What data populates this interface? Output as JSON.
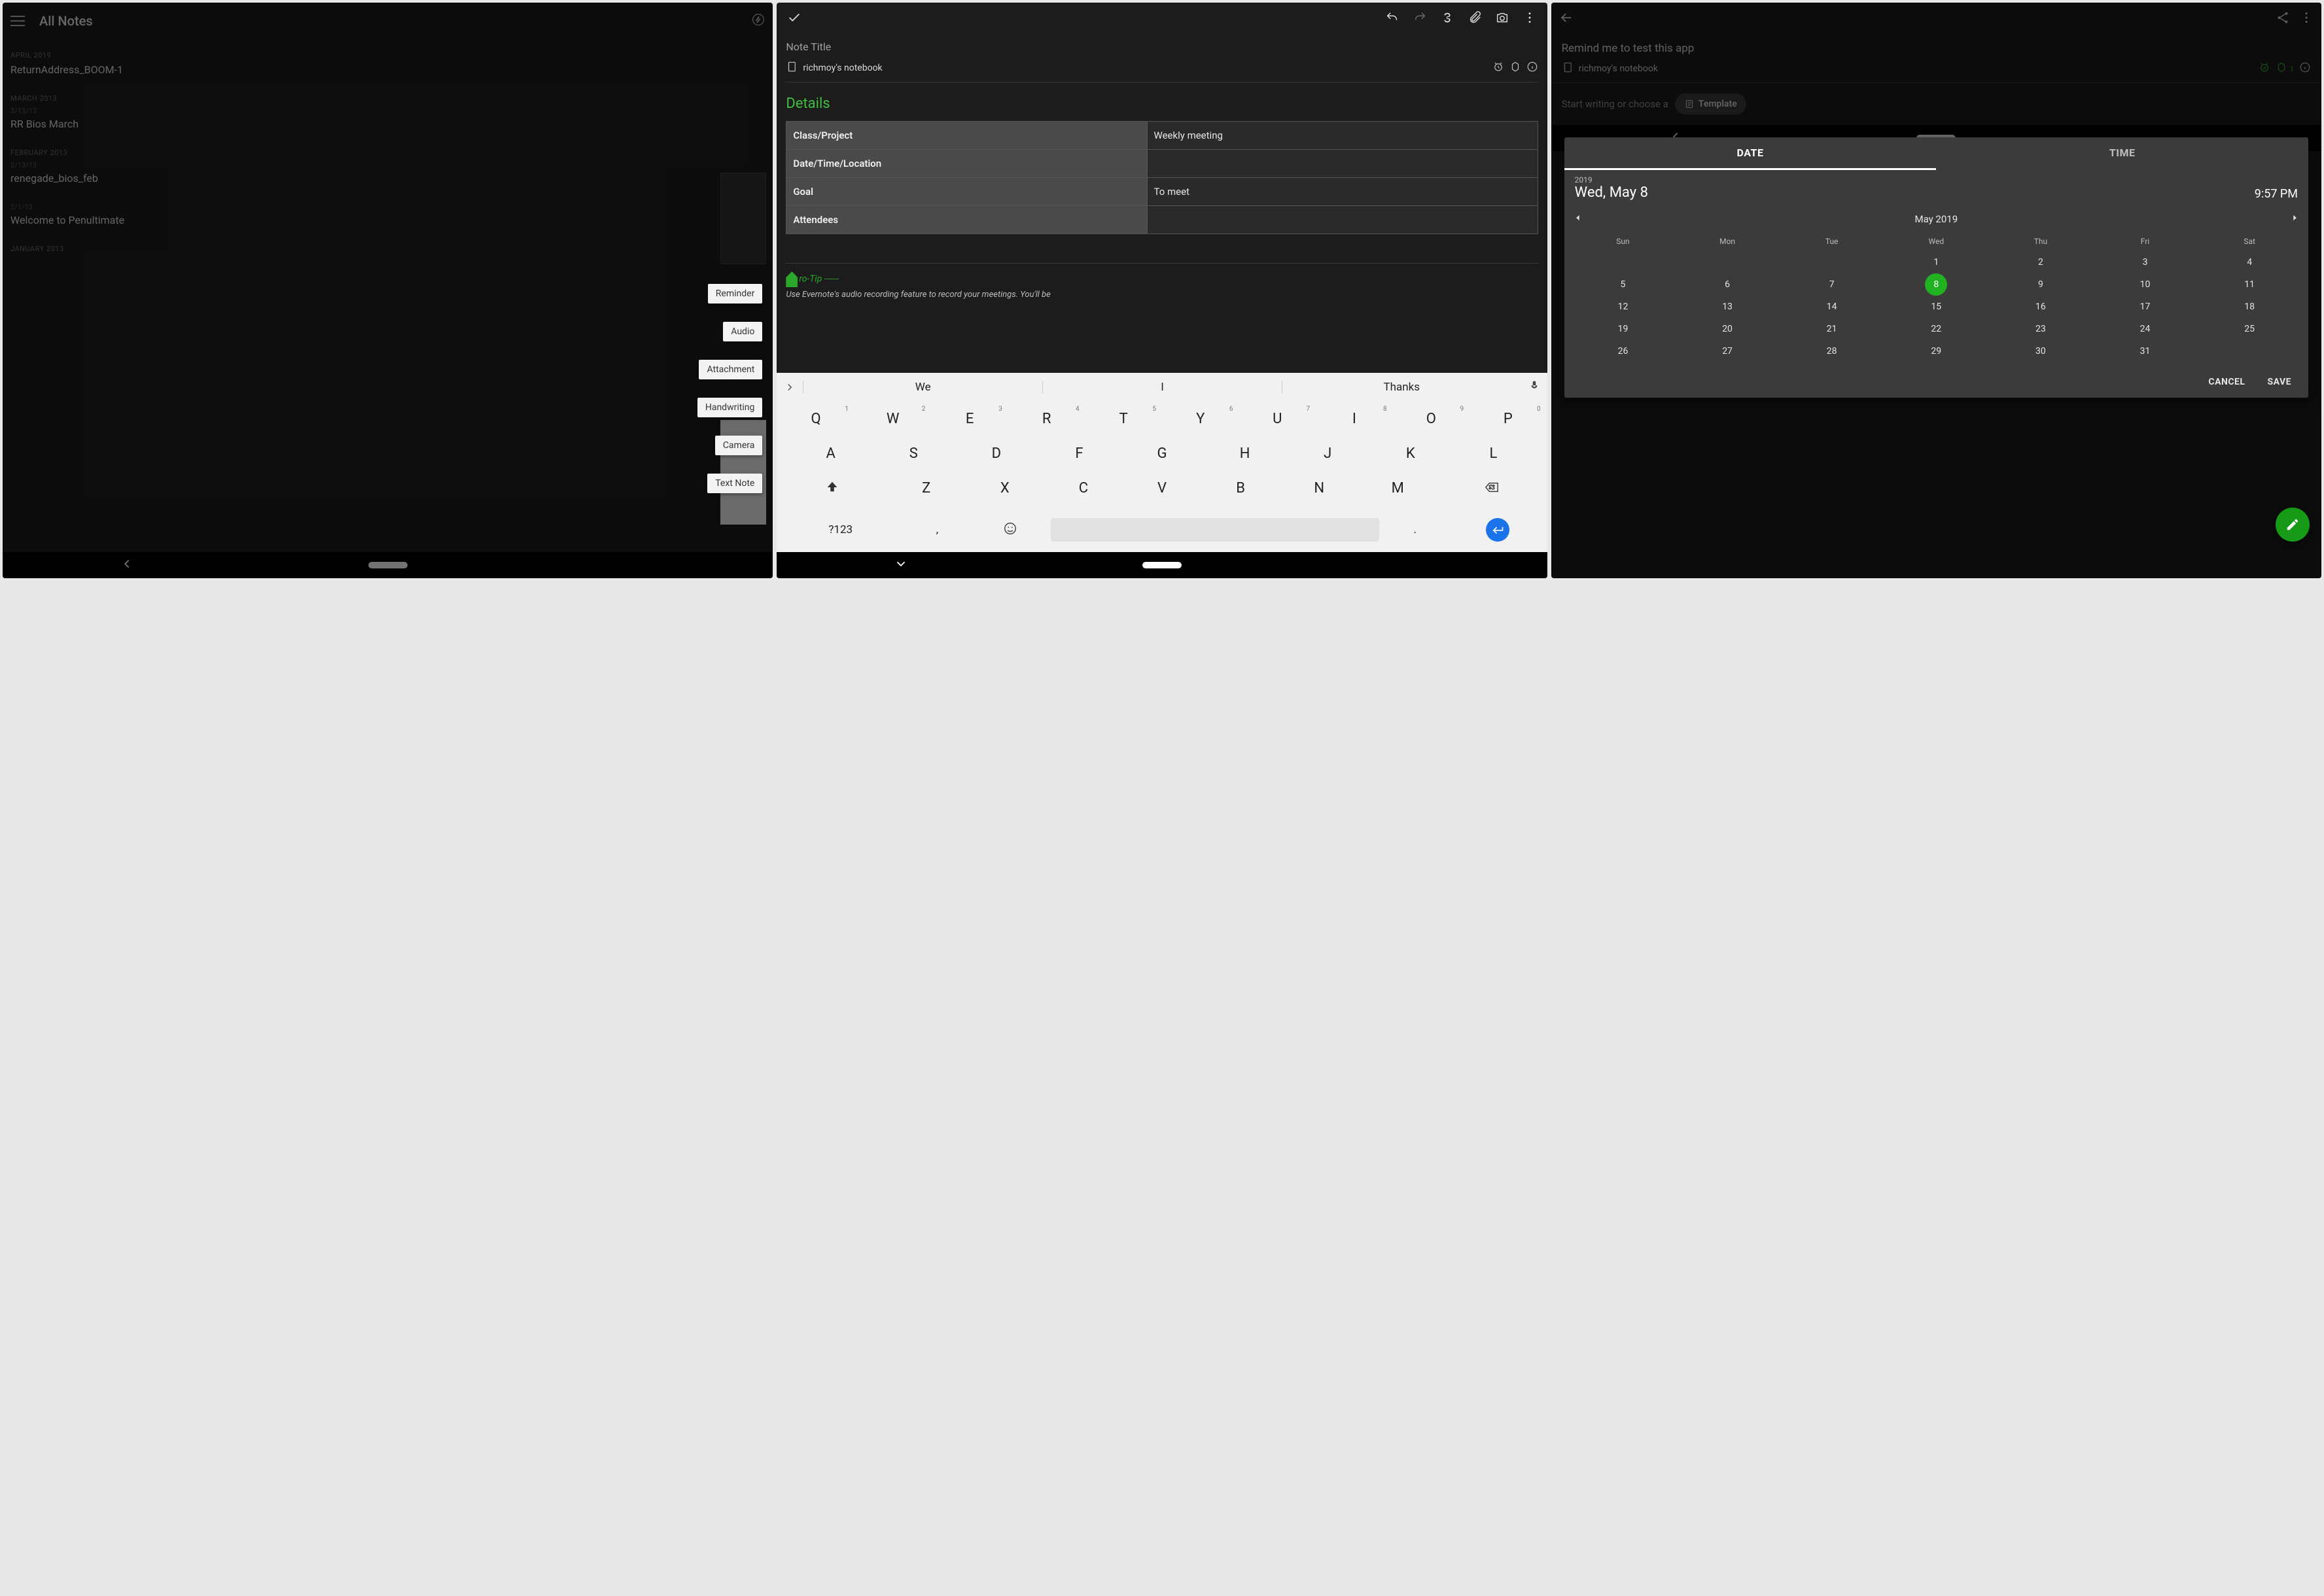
{
  "screen1": {
    "header_title": "All Notes",
    "sections": [
      {
        "label": "APRIL 2019",
        "notes": [
          {
            "date": "",
            "title": "ReturnAddress_BOOM-1"
          }
        ]
      },
      {
        "label": "MARCH 2013",
        "notes": [
          {
            "date": "3/13/13",
            "title": "RR Bios March"
          }
        ]
      },
      {
        "label": "FEBRUARY 2013",
        "notes": [
          {
            "date": "2/13/13",
            "title": "renegade_bios_feb"
          },
          {
            "date": "2/1/13",
            "title": "Welcome to Penultimate"
          }
        ]
      },
      {
        "label": "JANUARY 2013",
        "notes": []
      }
    ],
    "fab_menu": [
      "Reminder",
      "Audio",
      "Attachment",
      "Handwriting",
      "Camera",
      "Text Note"
    ]
  },
  "screen2": {
    "title_placeholder": "Note Title",
    "notebook": "richmoy's notebook",
    "section_heading": "Details",
    "table": [
      {
        "label": "Class/Project",
        "value": "Weekly meeting"
      },
      {
        "label": "Date/Time/Location",
        "value": ""
      },
      {
        "label": "Goal",
        "value": "To meet"
      },
      {
        "label": "Attendees",
        "value": ""
      }
    ],
    "protip_label": "ro-Tip ------",
    "protip_body": "Use Evernote's audio recording feature to record your meetings. You'll be",
    "keyboard": {
      "suggestions": [
        "We",
        "I",
        "Thanks"
      ],
      "row1": [
        {
          "k": "Q",
          "n": "1"
        },
        {
          "k": "W",
          "n": "2"
        },
        {
          "k": "E",
          "n": "3"
        },
        {
          "k": "R",
          "n": "4"
        },
        {
          "k": "T",
          "n": "5"
        },
        {
          "k": "Y",
          "n": "6"
        },
        {
          "k": "U",
          "n": "7"
        },
        {
          "k": "I",
          "n": "8"
        },
        {
          "k": "O",
          "n": "9"
        },
        {
          "k": "P",
          "n": "0"
        }
      ],
      "row2": [
        "A",
        "S",
        "D",
        "F",
        "G",
        "H",
        "J",
        "K",
        "L"
      ],
      "row3": [
        "Z",
        "X",
        "C",
        "V",
        "B",
        "N",
        "M"
      ],
      "sym": "?123",
      "comma": ",",
      "dot": "."
    }
  },
  "screen3": {
    "note_title": "Remind me to test this app",
    "notebook": "richmoy's notebook",
    "tag_count": "1",
    "placeholder": "Start writing or choose a",
    "template_label": "Template",
    "picker": {
      "tabs": {
        "date": "DATE",
        "time": "TIME",
        "active": "date"
      },
      "year": "2019",
      "selected_date": "Wed, May 8",
      "selected_time": "9:57 PM",
      "month_label": "May 2019",
      "dow": [
        "Sun",
        "Mon",
        "Tue",
        "Wed",
        "Thu",
        "Fri",
        "Sat"
      ],
      "weeks": [
        [
          "",
          "",
          "",
          "1",
          "2",
          "3",
          "4"
        ],
        [
          "5",
          "6",
          "7",
          "8",
          "9",
          "10",
          "11"
        ],
        [
          "12",
          "13",
          "14",
          "15",
          "16",
          "17",
          "18"
        ],
        [
          "19",
          "20",
          "21",
          "22",
          "23",
          "24",
          "25"
        ],
        [
          "26",
          "27",
          "28",
          "29",
          "30",
          "31",
          ""
        ]
      ],
      "selected_day": "8",
      "cancel": "CANCEL",
      "save": "SAVE"
    }
  }
}
